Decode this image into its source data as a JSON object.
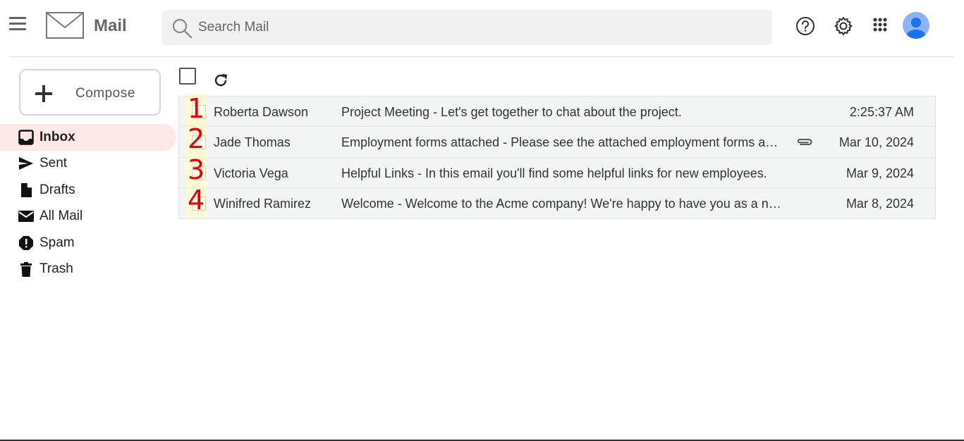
{
  "header": {
    "app_name": "Mail",
    "search_placeholder": "Search Mail"
  },
  "sidebar": {
    "compose_label": "Compose",
    "items": [
      {
        "label": "Inbox",
        "icon": "inbox-icon",
        "active": true
      },
      {
        "label": "Sent",
        "icon": "send-icon"
      },
      {
        "label": "Drafts",
        "icon": "draft-icon"
      },
      {
        "label": "All Mail",
        "icon": "mail-icon"
      },
      {
        "label": "Spam",
        "icon": "spam-icon"
      },
      {
        "label": "Trash",
        "icon": "trash-icon"
      }
    ]
  },
  "emails": [
    {
      "marker": "1",
      "sender": "Roberta Dawson",
      "preview": "Project Meeting - Let's get together to chat about the project.",
      "date": "2:25:37 AM",
      "attachment": false
    },
    {
      "marker": "2",
      "sender": "Jade Thomas",
      "preview": "Employment forms attached - Please see the attached employment forms and let me know if you have any questions.",
      "date": "Mar 10, 2024",
      "attachment": true
    },
    {
      "marker": "3",
      "sender": "Victoria Vega",
      "preview": "Helpful Links - In this email you'll find some helpful links for new employees.",
      "date": "Mar 9, 2024",
      "attachment": false
    },
    {
      "marker": "4",
      "sender": "Winifred Ramirez",
      "preview": "Welcome - Welcome to the Acme company! We're happy to have you as a new employee.",
      "date": "Mar 8, 2024",
      "attachment": false
    }
  ],
  "colors": {
    "active_nav_bg": "#fce8e6",
    "row_bg": "#f2f5f4",
    "marker_color": "#e00000",
    "avatar_bg": "#8ab4f8"
  }
}
